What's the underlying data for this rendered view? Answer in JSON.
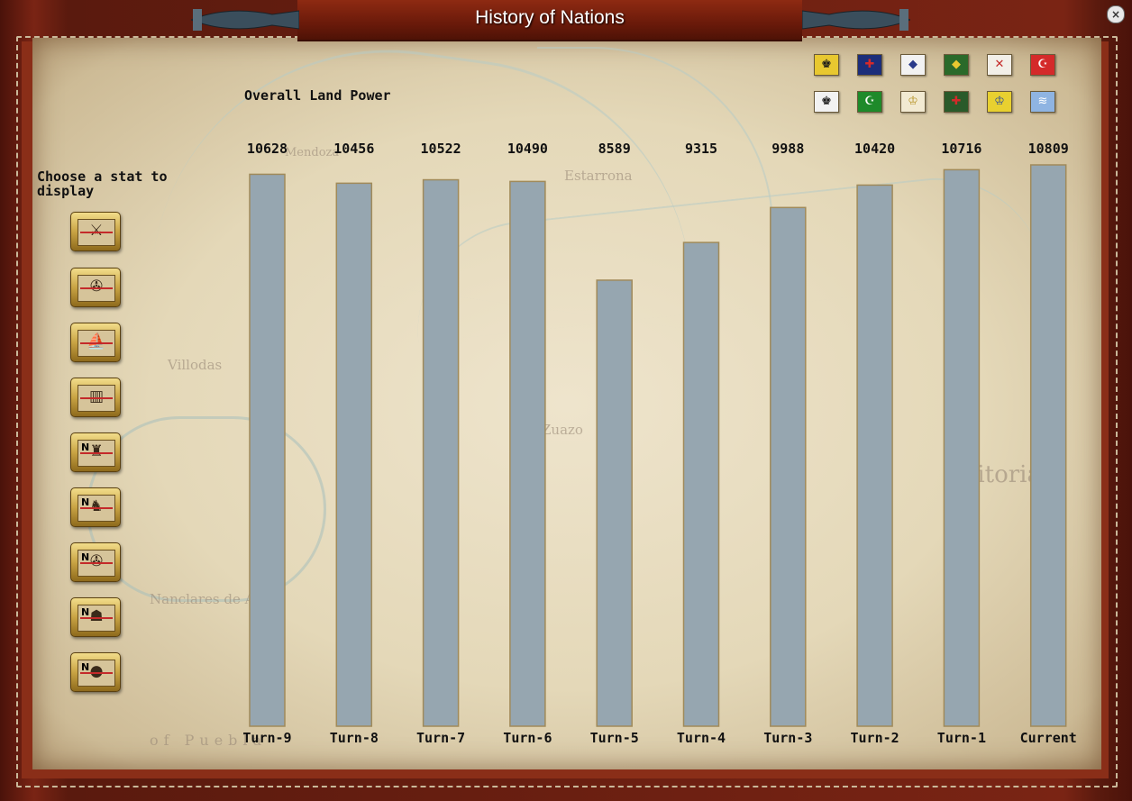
{
  "window": {
    "title": "History of Nations",
    "close_icon": "close-icon"
  },
  "stats_panel": {
    "prompt": "Choose a stat to display",
    "buttons": [
      {
        "icon": "nation-army-icon",
        "glyph": "⚔",
        "n_marker": ""
      },
      {
        "icon": "cannon-icon",
        "glyph": "✇",
        "n_marker": ""
      },
      {
        "icon": "ship-icon",
        "glyph": "⛵",
        "n_marker": ""
      },
      {
        "icon": "fort-icon",
        "glyph": "▥",
        "n_marker": ""
      },
      {
        "icon": "general-icon",
        "glyph": "♜",
        "n_marker": "N"
      },
      {
        "icon": "cavalry-icon",
        "glyph": "♞",
        "n_marker": "N"
      },
      {
        "icon": "artillery-icon",
        "glyph": "✇",
        "n_marker": "N"
      },
      {
        "icon": "casualties-icon",
        "glyph": "☗",
        "n_marker": "N"
      },
      {
        "icon": "captured-icon",
        "glyph": "●",
        "n_marker": "N"
      }
    ]
  },
  "nations": {
    "flags": [
      {
        "icon": "flag-russia-icon",
        "bg": "#e8c830",
        "fg": "#1a1a1a",
        "glyph": "♚"
      },
      {
        "icon": "flag-britain-icon",
        "bg": "#1c2e7a",
        "fg": "#d42a2a",
        "glyph": "✚"
      },
      {
        "icon": "flag-bavaria-icon",
        "bg": "#f2f2f2",
        "fg": "#2a3a8a",
        "glyph": "◆"
      },
      {
        "icon": "flag-portugal-icon",
        "bg": "#2a6a2a",
        "fg": "#e8c830",
        "glyph": "◆"
      },
      {
        "icon": "flag-spain-icon",
        "bg": "#f2efe8",
        "fg": "#c42a2a",
        "glyph": "✕"
      },
      {
        "icon": "flag-ottoman-icon",
        "bg": "#d42a2a",
        "fg": "#ffffff",
        "glyph": "☪"
      },
      {
        "icon": "flag-prussia-icon",
        "bg": "#f2f2f2",
        "fg": "#1a1a1a",
        "glyph": "♚"
      },
      {
        "icon": "flag-egypt-icon",
        "bg": "#1e8a2a",
        "fg": "#ffffff",
        "glyph": "☪"
      },
      {
        "icon": "flag-papal-icon",
        "bg": "#f2ead2",
        "fg": "#b8962a",
        "glyph": "♔"
      },
      {
        "icon": "flag-denmark-icon",
        "bg": "#2a5a2a",
        "fg": "#d42a2a",
        "glyph": "✚"
      },
      {
        "icon": "flag-sweden-icon",
        "bg": "#e8d030",
        "fg": "#2a4a9a",
        "glyph": "♔"
      },
      {
        "icon": "flag-bavaria-lozenge-icon",
        "bg": "#8fb4e2",
        "fg": "#ffffff",
        "glyph": "≋"
      }
    ]
  },
  "chart_data": {
    "type": "bar",
    "title": "Overall Land Power",
    "categories": [
      "Turn-9",
      "Turn-8",
      "Turn-7",
      "Turn-6",
      "Turn-5",
      "Turn-4",
      "Turn-3",
      "Turn-2",
      "Turn-1",
      "Current"
    ],
    "values": [
      10628,
      10456,
      10522,
      10490,
      8589,
      9315,
      9988,
      10420,
      10716,
      10809
    ],
    "data_labels": [
      "10628",
      "10456",
      "10522",
      "10490",
      "8589",
      "9315",
      "9988",
      "10420",
      "10716",
      "10809"
    ],
    "bar_color": "#96a6b0",
    "bar_border_color": "#a08a5a",
    "grid": false,
    "legend": "none"
  }
}
